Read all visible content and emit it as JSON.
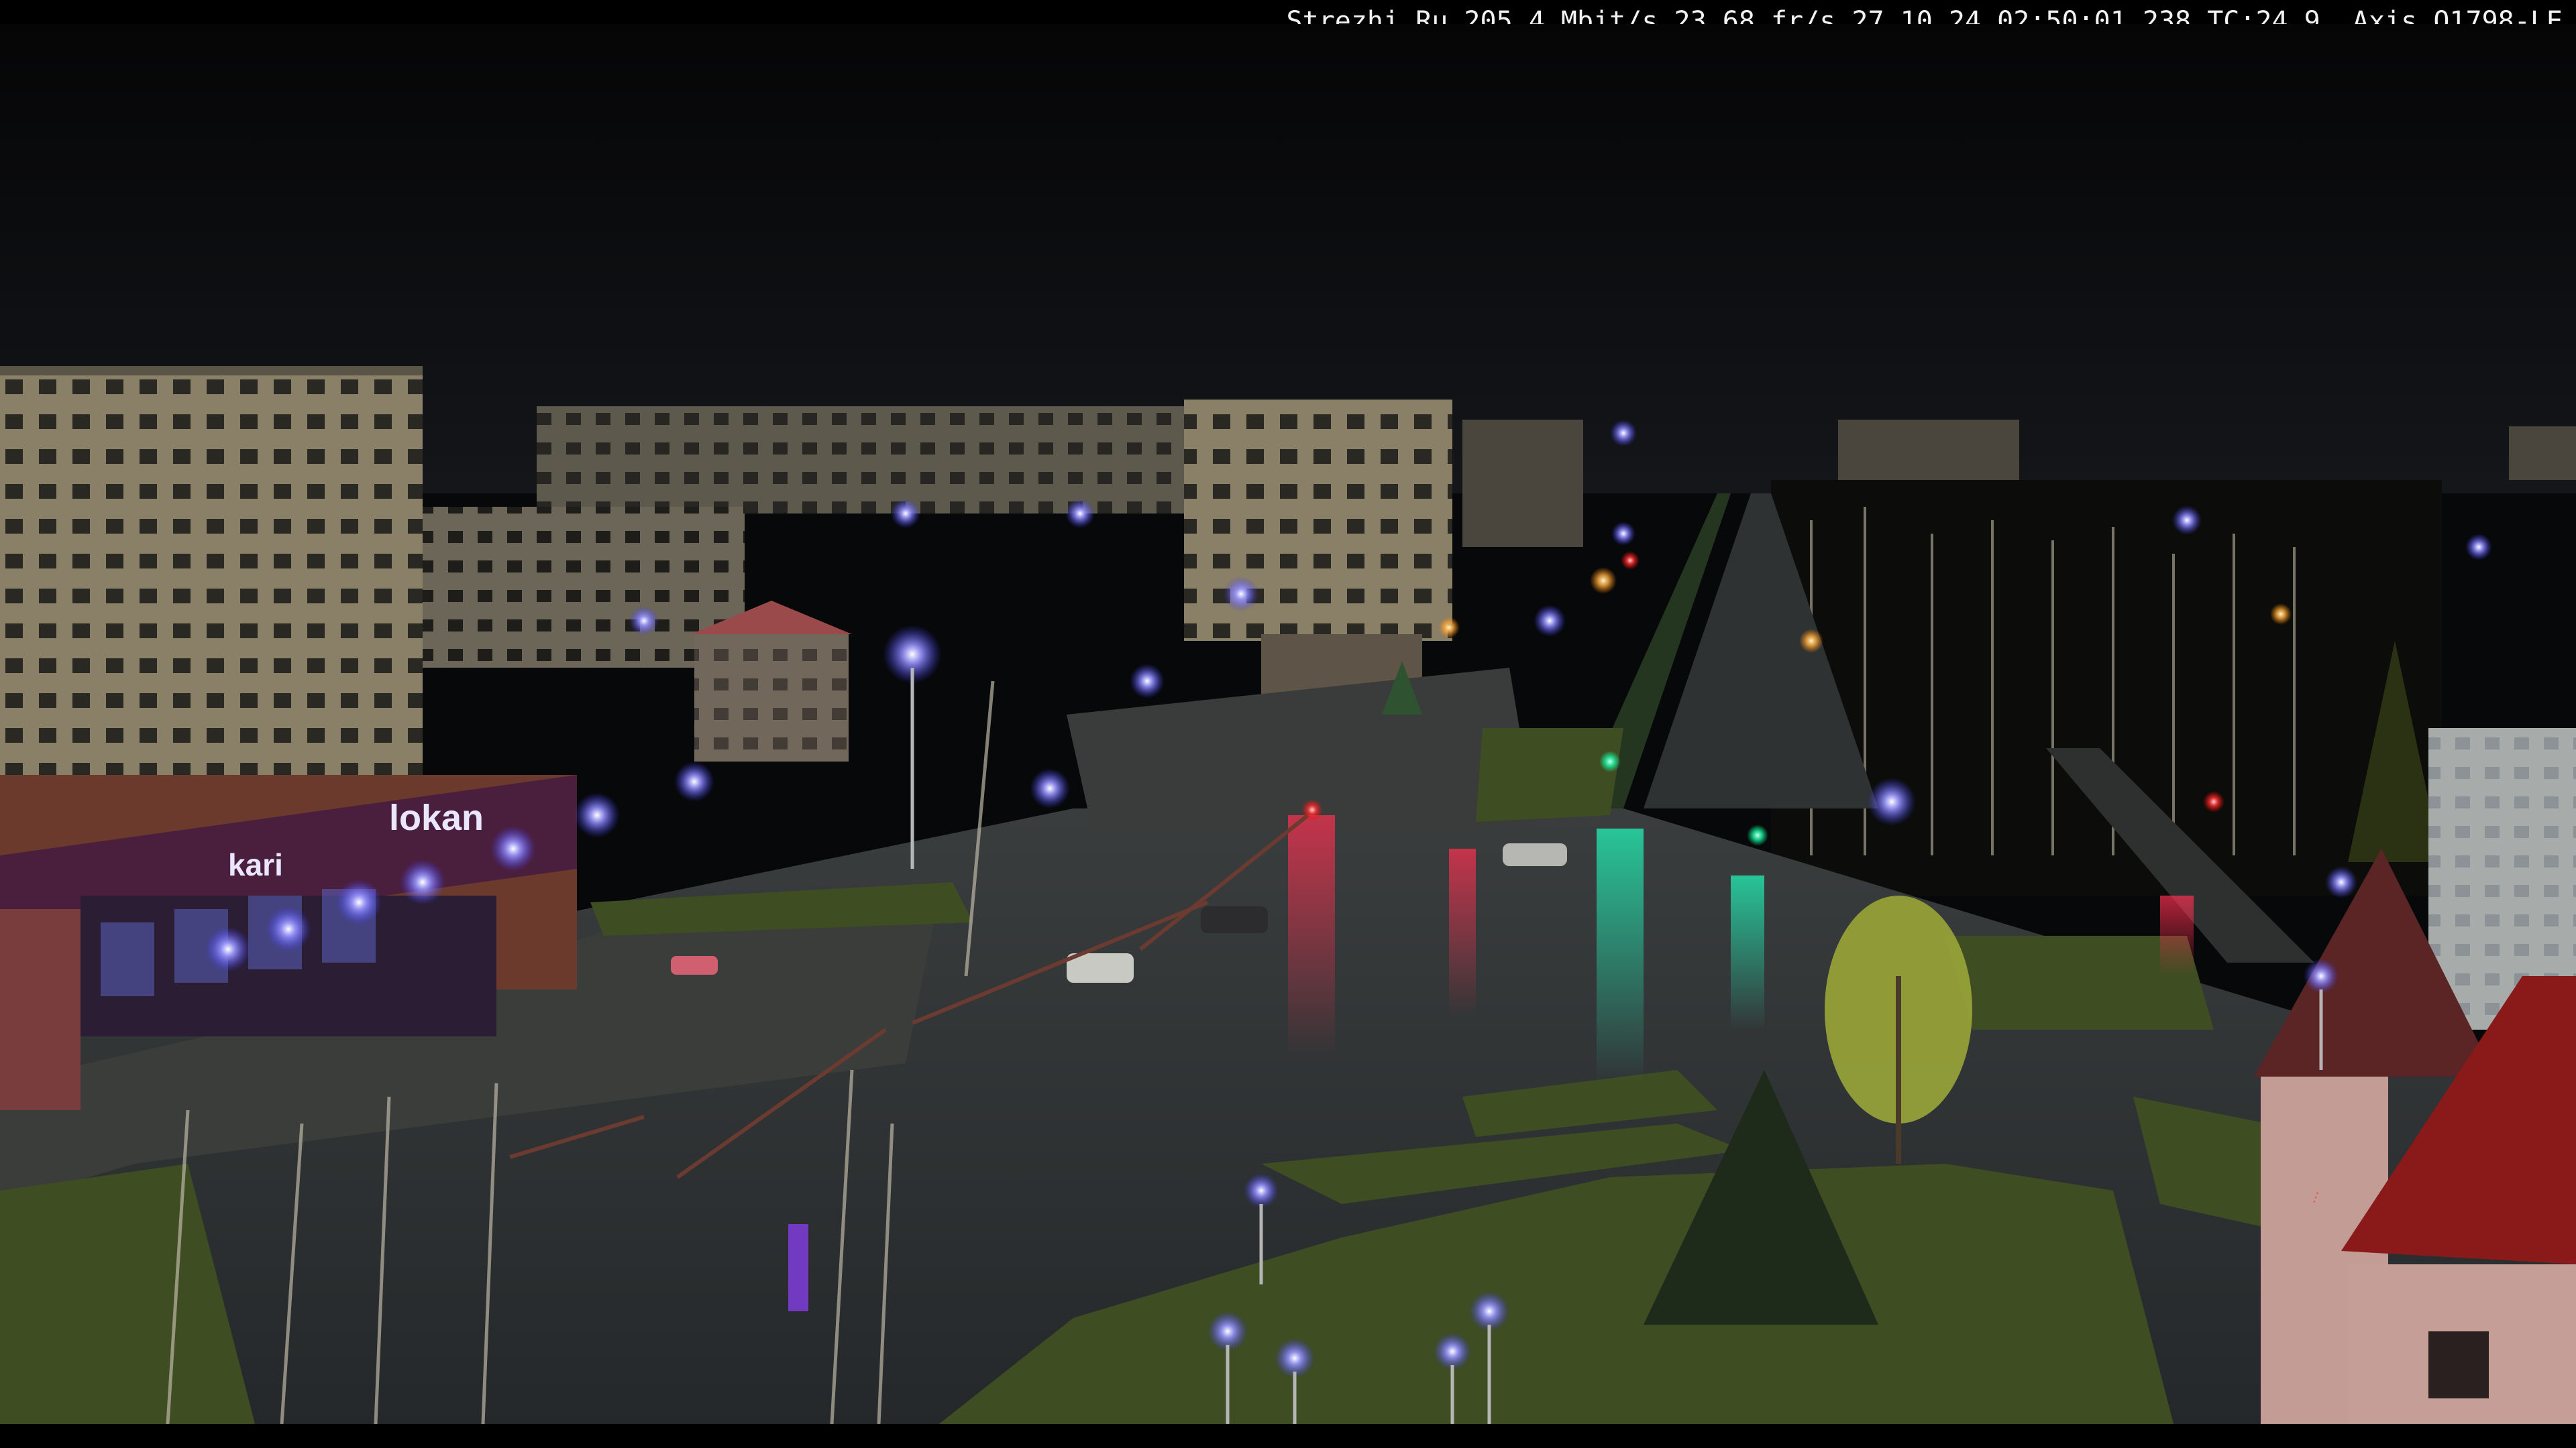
{
  "overlay": {
    "text": "Strezhi.Ru 205.4 Mbit/s 23.68 fr/s 27.10.24 02:50:01 238 TC:24.9  Axis Q1798-LE"
  },
  "signs": {
    "store_brand": "lokan",
    "store_lower": "kari"
  },
  "colors": {
    "sky": "#08090b",
    "asphalt": "#2a2d2c",
    "grass": "#3b4a25",
    "street_light": "#7a78ff",
    "building_light": "#8a8068",
    "red_building": "#7a2b24"
  }
}
